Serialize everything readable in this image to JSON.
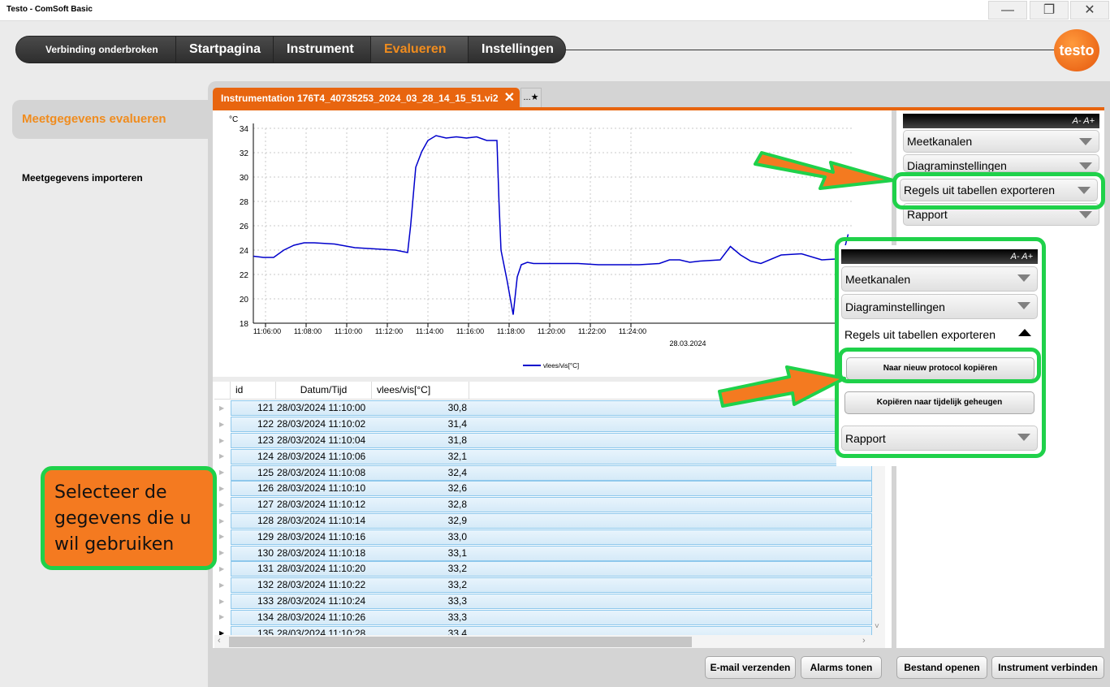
{
  "window": {
    "title": "Testo - ComSoft Basic"
  },
  "nav": {
    "items": [
      "Verbinding onderbroken",
      "Startpagina",
      "Instrument",
      "Evalueren",
      "Instellingen"
    ],
    "logo": "testo"
  },
  "sidebar": {
    "active": "Meetgegevens evalueren",
    "items": [
      "Meetgegevens importeren"
    ]
  },
  "tabs": {
    "file": "Instrumentation 176T4_40735253_2024_03_28_14_15_51.vi2",
    "extra": "..."
  },
  "chart_data": {
    "type": "line",
    "ylabel": "°C",
    "xlabel": "28.03.2024",
    "ylim": [
      18,
      34
    ],
    "yticks": [
      18,
      20,
      22,
      24,
      26,
      28,
      30,
      32,
      34
    ],
    "xticks": [
      "11:06:00",
      "11:08:00",
      "11:10:00",
      "11:12:00",
      "11:14:00",
      "11:16:00",
      "11:18:00",
      "11:20:00",
      "11:22:00",
      "11:24:00"
    ],
    "grid": true,
    "legend": "bottom",
    "series": [
      {
        "name": "vlees/vis[°C]",
        "color": "#0000cc",
        "x_minutes": [
          0,
          0.5,
          1,
          1.5,
          2,
          2.5,
          3,
          4,
          5,
          6,
          7,
          7.6,
          7.75,
          8,
          8.3,
          8.6,
          9,
          9.5,
          10,
          10.5,
          11,
          11.5,
          12,
          12.1,
          12.2,
          12.5,
          12.8,
          13,
          13.2,
          13.5,
          13.8,
          14,
          15,
          16,
          17,
          18,
          19,
          20,
          20.5,
          21,
          21.5,
          22,
          23,
          23.5,
          24,
          24.5,
          25,
          26,
          27,
          28,
          29,
          29.3
        ],
        "y": [
          23.5,
          23.4,
          23.4,
          24.0,
          24.4,
          24.6,
          24.6,
          24.5,
          24.2,
          24.1,
          24.0,
          23.8,
          26.0,
          30.8,
          32.1,
          33.0,
          33.4,
          33.2,
          33.3,
          33.2,
          33.3,
          33.0,
          33.0,
          28.0,
          24.0,
          21.5,
          18.7,
          21.8,
          22.8,
          23.0,
          22.9,
          22.9,
          22.9,
          22.9,
          22.8,
          22.8,
          22.8,
          22.9,
          23.2,
          23.2,
          23.0,
          23.1,
          23.2,
          24.3,
          23.6,
          23.1,
          22.9,
          23.6,
          23.7,
          23.2,
          23.3,
          25.3
        ]
      }
    ]
  },
  "table": {
    "columns": [
      "id",
      "Datum/Tijd",
      "vlees/vis[°C]"
    ],
    "rows": [
      [
        "121",
        "28/03/2024 11:10:00",
        "30,8"
      ],
      [
        "122",
        "28/03/2024 11:10:02",
        "31,4"
      ],
      [
        "123",
        "28/03/2024 11:10:04",
        "31,8"
      ],
      [
        "124",
        "28/03/2024 11:10:06",
        "32,1"
      ],
      [
        "125",
        "28/03/2024 11:10:08",
        "32,4"
      ],
      [
        "126",
        "28/03/2024 11:10:10",
        "32,6"
      ],
      [
        "127",
        "28/03/2024 11:10:12",
        "32,8"
      ],
      [
        "128",
        "28/03/2024 11:10:14",
        "32,9"
      ],
      [
        "129",
        "28/03/2024 11:10:16",
        "33,0"
      ],
      [
        "130",
        "28/03/2024 11:10:18",
        "33,1"
      ],
      [
        "131",
        "28/03/2024 11:10:20",
        "33,2"
      ],
      [
        "132",
        "28/03/2024 11:10:22",
        "33,2"
      ],
      [
        "133",
        "28/03/2024 11:10:24",
        "33,3"
      ],
      [
        "134",
        "28/03/2024 11:10:26",
        "33,3"
      ],
      [
        "135",
        "28/03/2024 11:10:28",
        "33,4"
      ]
    ]
  },
  "panel": {
    "header": "A- A+",
    "items": [
      "Meetkanalen",
      "Diagraminstellingen",
      "Regels uit tabellen exporteren",
      "Rapport"
    ]
  },
  "popup": {
    "header": "A- A+",
    "items": [
      "Meetkanalen",
      "Diagraminstellingen",
      "Regels uit tabellen exporteren",
      "Rapport"
    ],
    "actions": [
      "Naar nieuw protocol kopiëren",
      "Kopiëren naar tijdelijk geheugen"
    ]
  },
  "footer": {
    "buttons": [
      "E-mail verzenden",
      "Alarms tonen",
      "Bestand openen",
      "Instrument verbinden"
    ]
  },
  "note": {
    "text": "Selecteer de gegevens die u wil gebruiken"
  },
  "colors": {
    "accent": "#e8650f",
    "highlight": "#1fd14a",
    "note_bg": "#f47a20"
  }
}
